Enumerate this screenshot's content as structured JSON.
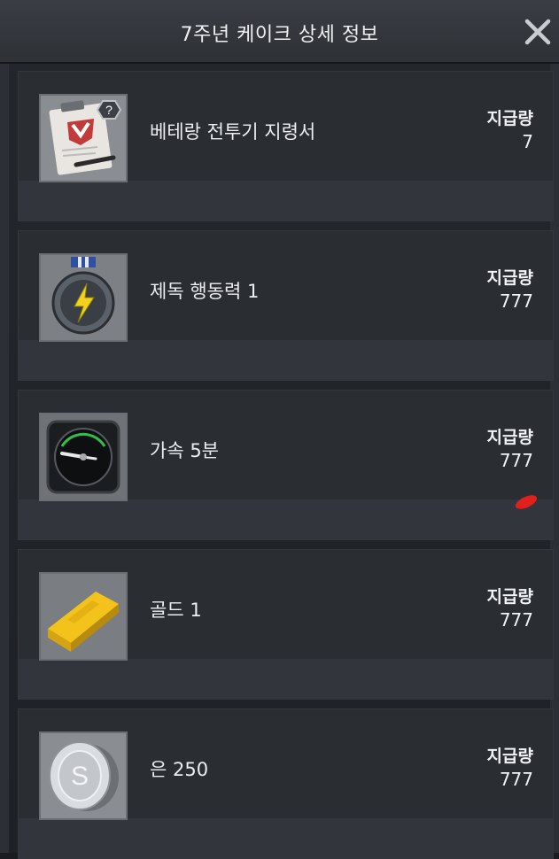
{
  "dialog": {
    "title": "7주년 케이크 상세 정보",
    "close_label": "✕"
  },
  "amount_label": "지급량",
  "items": [
    {
      "name": "베테랑 전투기 지령서",
      "amount": "7",
      "icon": "fighter-order-icon"
    },
    {
      "name": "제독 행동력 1",
      "amount": "777",
      "icon": "stamina-medal-icon"
    },
    {
      "name": "가속 5분",
      "amount": "777",
      "icon": "speedup-gauge-icon"
    },
    {
      "name": "골드 1",
      "amount": "777",
      "icon": "gold-bar-icon"
    },
    {
      "name": "은 250",
      "amount": "777",
      "icon": "silver-coin-icon"
    }
  ],
  "colors": {
    "background": "#1a1c20",
    "card": "#2a2d32",
    "text": "#f2f3f5",
    "mark": "#e0201c"
  }
}
